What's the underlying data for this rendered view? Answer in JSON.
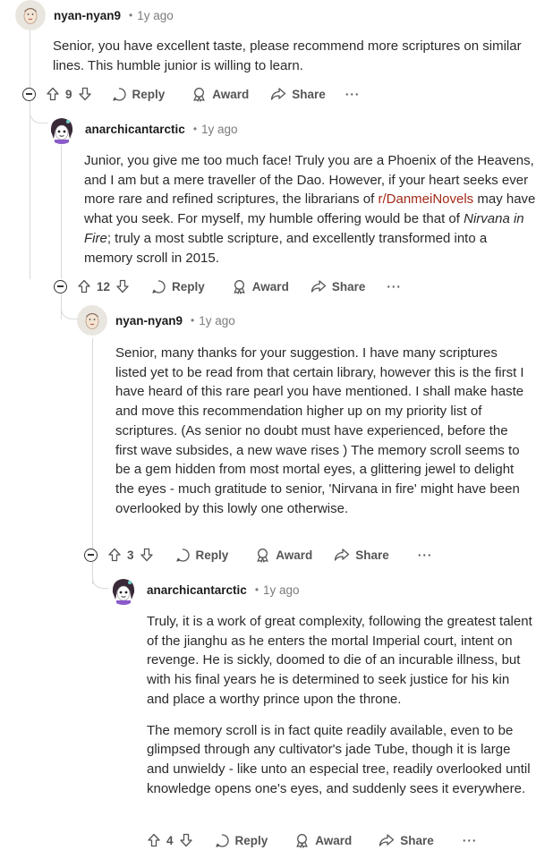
{
  "comments": [
    {
      "username": "nyan-nyan9",
      "dot": "•",
      "time": "1y ago",
      "paragraphs": [
        "Senior, you have excellent taste, please recommend more scriptures on similar lines. This humble junior is willing to learn."
      ],
      "votes": "9"
    },
    {
      "username": "anarchicantarctic",
      "dot": "•",
      "time": "1y ago",
      "text_before_link": "Junior, you give me too much face! Truly you are a Phoenix of the Heavens, and I am but a mere traveller of the Dao. However, if your heart seeks ever more rare and refined scriptures, the librarians of ",
      "link_text": "r/DanmeiNovels",
      "text_after_link": " may have what you seek. For myself, my humble offering would be that of ",
      "italic_text": "Nirvana in Fire",
      "text_end": "; truly a most subtle scripture, and excellently transformed into a memory scroll in 2015.",
      "votes": "12"
    },
    {
      "username": "nyan-nyan9",
      "dot": "•",
      "time": "1y ago",
      "paragraphs": [
        "Senior, many thanks for your suggestion. I have many scriptures listed yet to be read from that certain library, however this is the first I have heard of this rare pearl you have mentioned. I shall make haste and move this recommendation higher up on my priority list of scriptures. (As senior no doubt must have experienced, before the first wave subsides, a new wave rises ) The memory scroll seems to be a gem hidden from most mortal eyes, a glittering jewel to delight the eyes - much gratitude to senior, 'Nirvana in fire' might have been overlooked by this lowly one otherwise."
      ],
      "votes": "3"
    },
    {
      "username": "anarchicantarctic",
      "dot": "•",
      "time": "1y ago",
      "paragraphs": [
        "Truly, it is a work of great complexity, following the greatest talent of the jianghu as he enters the mortal Imperial court, intent on revenge. He is sickly, doomed to die of an incurable illness, but with his final years he is determined to seek justice for his kin and place a worthy prince upon the throne.",
        "The memory scroll is in fact quite readily available, even to be glimpsed through any cultivator's  jade Tube, though it is large and unwieldy - like unto an especial tree, readily overlooked until knowledge opens one's eyes, and suddenly sees it everywhere."
      ],
      "votes": "4"
    }
  ],
  "actions": {
    "reply": "Reply",
    "award": "Award",
    "share": "Share",
    "more": "···"
  },
  "colors": {
    "link": "#a32a17",
    "thread_line": "#d7dadc",
    "meta_text": "#7c7c7c",
    "action_text": "#555555"
  },
  "icons": [
    "collapse-icon",
    "upvote-icon",
    "downvote-icon",
    "reply-bubble-icon",
    "award-icon",
    "share-icon",
    "more-icon"
  ]
}
